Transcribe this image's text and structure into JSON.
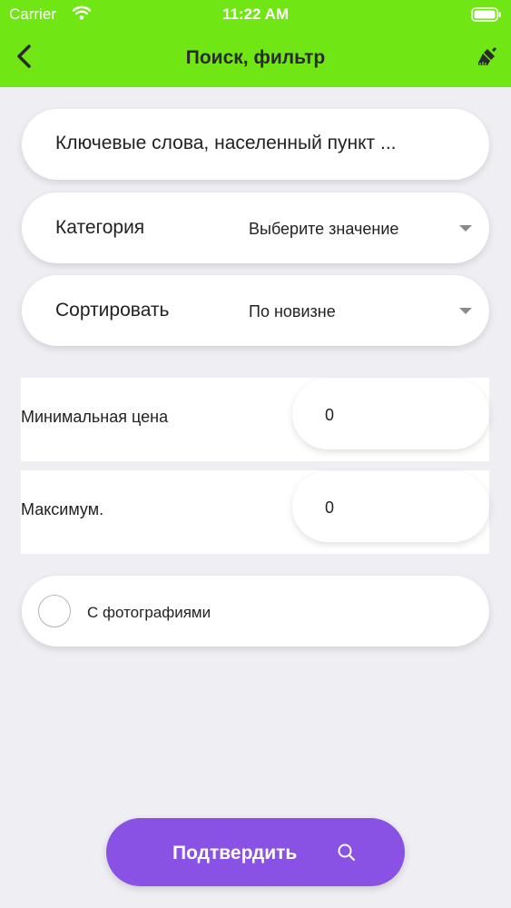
{
  "status_bar": {
    "carrier": "Carrier",
    "time": "11:22 AM"
  },
  "navbar": {
    "title": "Поиск, фильтр",
    "back_icon": "chevron-left-icon",
    "action_icon": "brush-icon"
  },
  "keywords": {
    "placeholder": "Ключевые слова, населенный пункт ..."
  },
  "category": {
    "label": "Категория",
    "value": "Выберите значение"
  },
  "sort": {
    "label": "Сортировать",
    "value": "По новизне"
  },
  "min_price": {
    "label": "Минимальная цена",
    "value": "0"
  },
  "max_price": {
    "label": "Максимум.",
    "value": "0"
  },
  "photo_filter": {
    "label": "С фотографиями",
    "checked": false
  },
  "confirm": {
    "label": "Подтвердить",
    "icon": "search-icon"
  },
  "colors": {
    "header": "#70e614",
    "accent": "#8a52e4",
    "background": "#efeef3"
  }
}
